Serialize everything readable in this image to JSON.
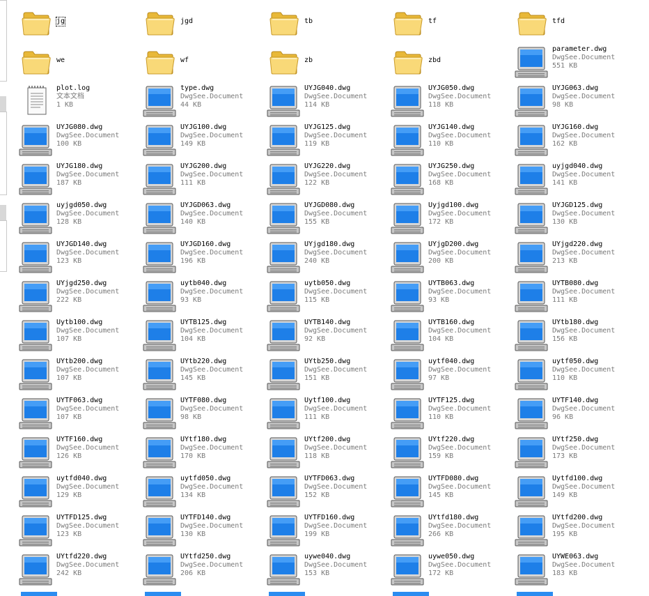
{
  "window": {
    "title": ""
  },
  "files": [
    {
      "name": "jg",
      "kind": "folder"
    },
    {
      "name": "jgd",
      "kind": "folder"
    },
    {
      "name": "tb",
      "kind": "folder"
    },
    {
      "name": "tf",
      "kind": "folder"
    },
    {
      "name": "tfd",
      "kind": "folder"
    },
    {
      "name": "we",
      "kind": "folder"
    },
    {
      "name": "wf",
      "kind": "folder"
    },
    {
      "name": "zb",
      "kind": "folder"
    },
    {
      "name": "zbd",
      "kind": "folder"
    },
    {
      "name": "parameter.dwg",
      "kind": "dwg",
      "type": "DwgSee.Document",
      "size": "551 KB"
    },
    {
      "name": "plot.log",
      "kind": "text",
      "type": "文本文档",
      "size": "1 KB"
    },
    {
      "name": "type.dwg",
      "kind": "dwg",
      "type": "DwgSee.Document",
      "size": "44 KB"
    },
    {
      "name": "UYJG040.dwg",
      "kind": "dwg",
      "type": "DwgSee.Document",
      "size": "114 KB"
    },
    {
      "name": "UYJG050.dwg",
      "kind": "dwg",
      "type": "DwgSee.Document",
      "size": "118 KB"
    },
    {
      "name": "UYJG063.dwg",
      "kind": "dwg",
      "type": "DwgSee.Document",
      "size": "98 KB"
    },
    {
      "name": "UYJG080.dwg",
      "kind": "dwg",
      "type": "DwgSee.Document",
      "size": "100 KB"
    },
    {
      "name": "UYJG100.dwg",
      "kind": "dwg",
      "type": "DwgSee.Document",
      "size": "149 KB"
    },
    {
      "name": "UYJG125.dwg",
      "kind": "dwg",
      "type": "DwgSee.Document",
      "size": "119 KB"
    },
    {
      "name": "UYJG140.dwg",
      "kind": "dwg",
      "type": "DwgSee.Document",
      "size": "110 KB"
    },
    {
      "name": "UYJG160.dwg",
      "kind": "dwg",
      "type": "DwgSee.Document",
      "size": "162 KB"
    },
    {
      "name": "UYJG180.dwg",
      "kind": "dwg",
      "type": "DwgSee.Document",
      "size": "187 KB"
    },
    {
      "name": "UYJG200.dwg",
      "kind": "dwg",
      "type": "DwgSee.Document",
      "size": "111 KB"
    },
    {
      "name": "UYJG220.dwg",
      "kind": "dwg",
      "type": "DwgSee.Document",
      "size": "122 KB"
    },
    {
      "name": "UYJG250.dwg",
      "kind": "dwg",
      "type": "DwgSee.Document",
      "size": "168 KB"
    },
    {
      "name": "uyjgd040.dwg",
      "kind": "dwg",
      "type": "DwgSee.Document",
      "size": "141 KB"
    },
    {
      "name": "uyjgd050.dwg",
      "kind": "dwg",
      "type": "DwgSee.Document",
      "size": "128 KB"
    },
    {
      "name": "UYJGD063.dwg",
      "kind": "dwg",
      "type": "DwgSee.Document",
      "size": "140 KB"
    },
    {
      "name": "UYJGD080.dwg",
      "kind": "dwg",
      "type": "DwgSee.Document",
      "size": "155 KB"
    },
    {
      "name": "Uyjgd100.dwg",
      "kind": "dwg",
      "type": "DwgSee.Document",
      "size": "172 KB"
    },
    {
      "name": "UYJGD125.dwg",
      "kind": "dwg",
      "type": "DwgSee.Document",
      "size": "130 KB"
    },
    {
      "name": "UYJGD140.dwg",
      "kind": "dwg",
      "type": "DwgSee.Document",
      "size": "123 KB"
    },
    {
      "name": "UYJGD160.dwg",
      "kind": "dwg",
      "type": "DwgSee.Document",
      "size": "196 KB"
    },
    {
      "name": "UYjgd180.dwg",
      "kind": "dwg",
      "type": "DwgSee.Document",
      "size": "240 KB"
    },
    {
      "name": "UYjgD200.dwg",
      "kind": "dwg",
      "type": "DwgSee.Document",
      "size": "200 KB"
    },
    {
      "name": "UYjgd220.dwg",
      "kind": "dwg",
      "type": "DwgSee.Document",
      "size": "213 KB"
    },
    {
      "name": "UYjgd250.dwg",
      "kind": "dwg",
      "type": "DwgSee.Document",
      "size": "222 KB"
    },
    {
      "name": "uytb040.dwg",
      "kind": "dwg",
      "type": "DwgSee.Document",
      "size": "93 KB"
    },
    {
      "name": "uytb050.dwg",
      "kind": "dwg",
      "type": "DwgSee.Document",
      "size": "115 KB"
    },
    {
      "name": "UYTB063.dwg",
      "kind": "dwg",
      "type": "DwgSee.Document",
      "size": "93 KB"
    },
    {
      "name": "UYTB080.dwg",
      "kind": "dwg",
      "type": "DwgSee.Document",
      "size": "111 KB"
    },
    {
      "name": "Uytb100.dwg",
      "kind": "dwg",
      "type": "DwgSee.Document",
      "size": "107 KB"
    },
    {
      "name": "UYTB125.dwg",
      "kind": "dwg",
      "type": "DwgSee.Document",
      "size": "104 KB"
    },
    {
      "name": "UYTB140.dwg",
      "kind": "dwg",
      "type": "DwgSee.Document",
      "size": "92 KB"
    },
    {
      "name": "UYTB160.dwg",
      "kind": "dwg",
      "type": "DwgSee.Document",
      "size": "104 KB"
    },
    {
      "name": "UYtb180.dwg",
      "kind": "dwg",
      "type": "DwgSee.Document",
      "size": "156 KB"
    },
    {
      "name": "UYtb200.dwg",
      "kind": "dwg",
      "type": "DwgSee.Document",
      "size": "107 KB"
    },
    {
      "name": "UYtb220.dwg",
      "kind": "dwg",
      "type": "DwgSee.Document",
      "size": "145 KB"
    },
    {
      "name": "UYtb250.dwg",
      "kind": "dwg",
      "type": "DwgSee.Document",
      "size": "151 KB"
    },
    {
      "name": "uytf040.dwg",
      "kind": "dwg",
      "type": "DwgSee.Document",
      "size": "97 KB"
    },
    {
      "name": "uytf050.dwg",
      "kind": "dwg",
      "type": "DwgSee.Document",
      "size": "110 KB"
    },
    {
      "name": "UYTF063.dwg",
      "kind": "dwg",
      "type": "DwgSee.Document",
      "size": "107 KB"
    },
    {
      "name": "UYTF080.dwg",
      "kind": "dwg",
      "type": "DwgSee.Document",
      "size": "98 KB"
    },
    {
      "name": "Uytf100.dwg",
      "kind": "dwg",
      "type": "DwgSee.Document",
      "size": "111 KB"
    },
    {
      "name": "UYTF125.dwg",
      "kind": "dwg",
      "type": "DwgSee.Document",
      "size": "110 KB"
    },
    {
      "name": "UYTF140.dwg",
      "kind": "dwg",
      "type": "DwgSee.Document",
      "size": "96 KB"
    },
    {
      "name": "UYTF160.dwg",
      "kind": "dwg",
      "type": "DwgSee.Document",
      "size": "126 KB"
    },
    {
      "name": "UYtf180.dwg",
      "kind": "dwg",
      "type": "DwgSee.Document",
      "size": "170 KB"
    },
    {
      "name": "UYtf200.dwg",
      "kind": "dwg",
      "type": "DwgSee.Document",
      "size": "118 KB"
    },
    {
      "name": "UYtf220.dwg",
      "kind": "dwg",
      "type": "DwgSee.Document",
      "size": "159 KB"
    },
    {
      "name": "UYtf250.dwg",
      "kind": "dwg",
      "type": "DwgSee.Document",
      "size": "173 KB"
    },
    {
      "name": "uytfd040.dwg",
      "kind": "dwg",
      "type": "DwgSee.Document",
      "size": "129 KB"
    },
    {
      "name": "uytfd050.dwg",
      "kind": "dwg",
      "type": "DwgSee.Document",
      "size": "134 KB"
    },
    {
      "name": "UYTFD063.dwg",
      "kind": "dwg",
      "type": "DwgSee.Document",
      "size": "152 KB"
    },
    {
      "name": "UYTFD080.dwg",
      "kind": "dwg",
      "type": "DwgSee.Document",
      "size": "145 KB"
    },
    {
      "name": "Uytfd100.dwg",
      "kind": "dwg",
      "type": "DwgSee.Document",
      "size": "149 KB"
    },
    {
      "name": "UYTFD125.dwg",
      "kind": "dwg",
      "type": "DwgSee.Document",
      "size": "123 KB"
    },
    {
      "name": "UYTFD140.dwg",
      "kind": "dwg",
      "type": "DwgSee.Document",
      "size": "130 KB"
    },
    {
      "name": "UYTFD160.dwg",
      "kind": "dwg",
      "type": "DwgSee.Document",
      "size": "199 KB"
    },
    {
      "name": "UYtfd180.dwg",
      "kind": "dwg",
      "type": "DwgSee.Document",
      "size": "266 KB"
    },
    {
      "name": "UYtfd200.dwg",
      "kind": "dwg",
      "type": "DwgSee.Document",
      "size": "195 KB"
    },
    {
      "name": "UYtfd220.dwg",
      "kind": "dwg",
      "type": "DwgSee.Document",
      "size": "242 KB"
    },
    {
      "name": "UYtfd250.dwg",
      "kind": "dwg",
      "type": "DwgSee.Document",
      "size": "206 KB"
    },
    {
      "name": "uywe040.dwg",
      "kind": "dwg",
      "type": "DwgSee.Document",
      "size": "153 KB"
    },
    {
      "name": "uywe050.dwg",
      "kind": "dwg",
      "type": "DwgSee.Document",
      "size": "172 KB"
    },
    {
      "name": "UYWE063.dwg",
      "kind": "dwg",
      "type": "DwgSee.Document",
      "size": "183 KB"
    }
  ],
  "icons": {
    "folder": "folder-icon",
    "dwg": "computer-monitor-icon",
    "text": "text-document-icon"
  },
  "colors": {
    "folder_fill": "#f7d35e",
    "monitor_screen": "#2b8cf0",
    "secondary_text": "#7a7a7a"
  }
}
